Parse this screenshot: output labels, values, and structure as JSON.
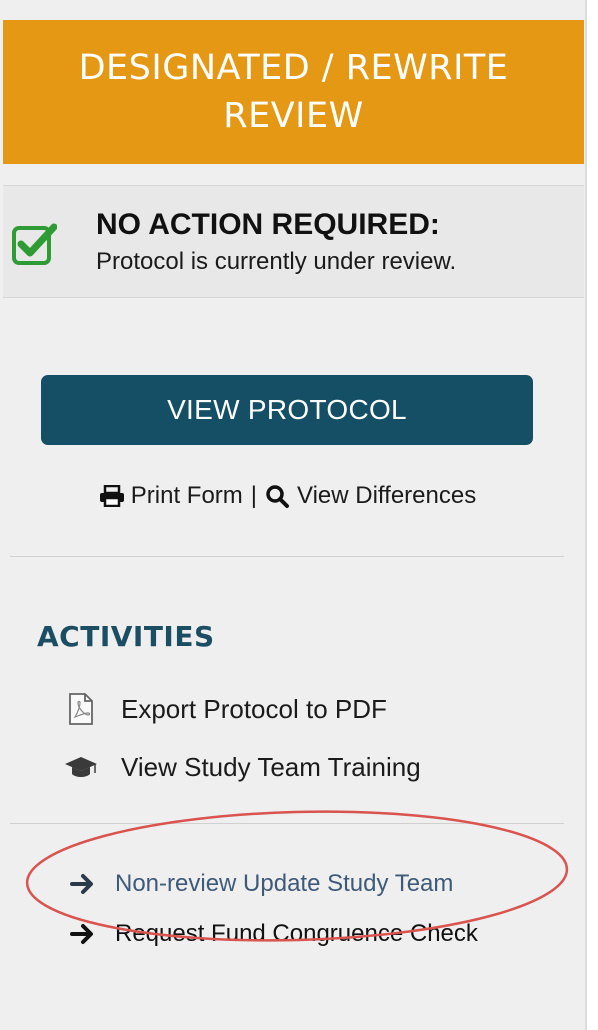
{
  "banner": {
    "line1": "DESIGNATED / REWRITE",
    "line2": "REVIEW",
    "color": "#e59814"
  },
  "notice": {
    "title": "NO ACTION REQUIRED:",
    "text": "Protocol is currently under review.",
    "icon": "checkbox-checked-icon"
  },
  "view_protocol_label": "VIEW PROTOCOL",
  "form_links": {
    "print": "Print Form",
    "separator": "|",
    "differences": "View Differences"
  },
  "activities": {
    "heading": "ACTIVITIES",
    "items": [
      {
        "label": "Export Protocol to PDF",
        "icon": "pdf-file-icon"
      },
      {
        "label": "View Study Team Training",
        "icon": "graduation-cap-icon"
      }
    ]
  },
  "actions": [
    {
      "label": "Non-review Update Study Team",
      "icon": "arrow-right-icon"
    },
    {
      "label": "Request Fund Congruence Check",
      "icon": "arrow-right-icon"
    }
  ],
  "colors": {
    "primary": "#144f66",
    "heading": "#1c4e63",
    "annotation": "#d9534f",
    "check": "#2e9b34"
  }
}
